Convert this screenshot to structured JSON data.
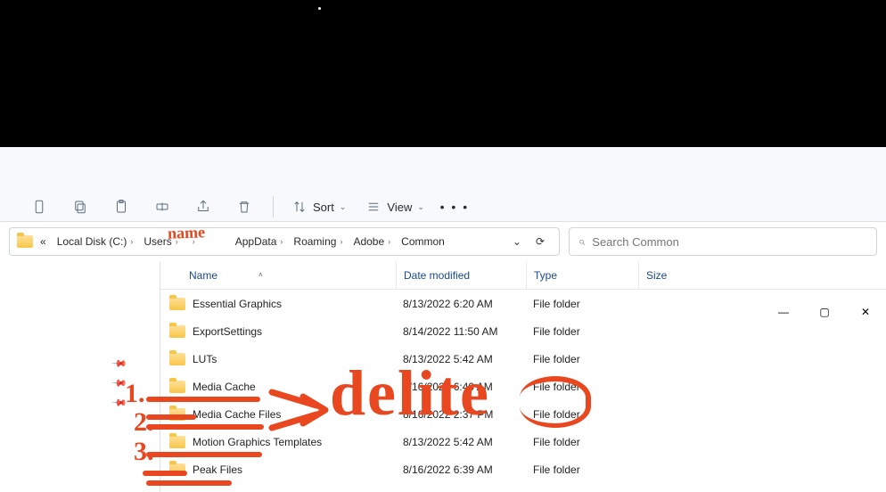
{
  "annotations": {
    "name_label": "name",
    "delite_label": "delite",
    "num1": "1.",
    "num2": "2.",
    "num3": "3."
  },
  "window_controls": {
    "min": "—",
    "max": "▢",
    "close": "✕"
  },
  "toolbar": {
    "sort_label": "Sort",
    "view_label": "View",
    "more": "• • •"
  },
  "breadcrumbs": {
    "overflow": "«",
    "items": [
      "Local Disk (C:)",
      "Users",
      "",
      "AppData",
      "Roaming",
      "Adobe",
      "Common"
    ]
  },
  "search": {
    "placeholder": "Search Common"
  },
  "columns": {
    "name": "Name",
    "date": "Date modified",
    "type": "Type",
    "size": "Size"
  },
  "rows": [
    {
      "name": "Essential Graphics",
      "date": "8/13/2022 6:20 AM",
      "type": "File folder",
      "size": ""
    },
    {
      "name": "ExportSettings",
      "date": "8/14/2022 11:50 AM",
      "type": "File folder",
      "size": ""
    },
    {
      "name": "LUTs",
      "date": "8/13/2022 5:42 AM",
      "type": "File folder",
      "size": ""
    },
    {
      "name": "Media Cache",
      "date": "8/16/2022 6:40 AM",
      "type": "File folder",
      "size": ""
    },
    {
      "name": "Media Cache Files",
      "date": "8/16/2022 2:37 PM",
      "type": "File folder",
      "size": ""
    },
    {
      "name": "Motion Graphics Templates",
      "date": "8/13/2022 5:42 AM",
      "type": "File folder",
      "size": ""
    },
    {
      "name": "Peak Files",
      "date": "8/16/2022 6:39 AM",
      "type": "File folder",
      "size": ""
    }
  ]
}
